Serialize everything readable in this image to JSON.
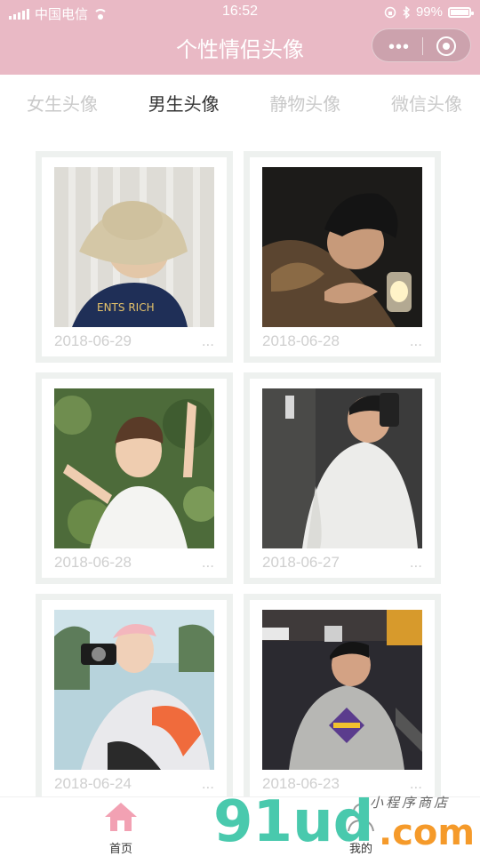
{
  "status": {
    "carrier": "中国电信",
    "time": "16:52",
    "battery": "99%"
  },
  "nav": {
    "title": "个性情侣头像",
    "more_icon": "more-dots-icon",
    "target_icon": "target-icon"
  },
  "tabs": [
    {
      "label": "女生头像"
    },
    {
      "label": "男生头像"
    },
    {
      "label": "静物头像"
    },
    {
      "label": "微信头像"
    }
  ],
  "cards": [
    {
      "date": "2018-06-29",
      "more": "...",
      "photo": "man-bucket-hat"
    },
    {
      "date": "2018-06-28",
      "more": "...",
      "photo": "man-candle-night"
    },
    {
      "date": "2018-06-28",
      "more": "...",
      "photo": "man-peace-sign"
    },
    {
      "date": "2018-06-27",
      "more": "...",
      "photo": "man-mirror-selfie"
    },
    {
      "date": "2018-06-24",
      "more": "...",
      "photo": "man-camera"
    },
    {
      "date": "2018-06-23",
      "more": "...",
      "photo": "man-lakers-hoodie"
    }
  ],
  "bottom": {
    "home_label": "首页",
    "me_label": "我的"
  },
  "watermark": {
    "big": "91ud",
    "com": ".com",
    "small": "小程序商店"
  },
  "colors": {
    "header": "#e9b9c5",
    "tab_active": "#333333",
    "tab_inactive": "#c9c9c9",
    "date": "#cfcfcf"
  }
}
